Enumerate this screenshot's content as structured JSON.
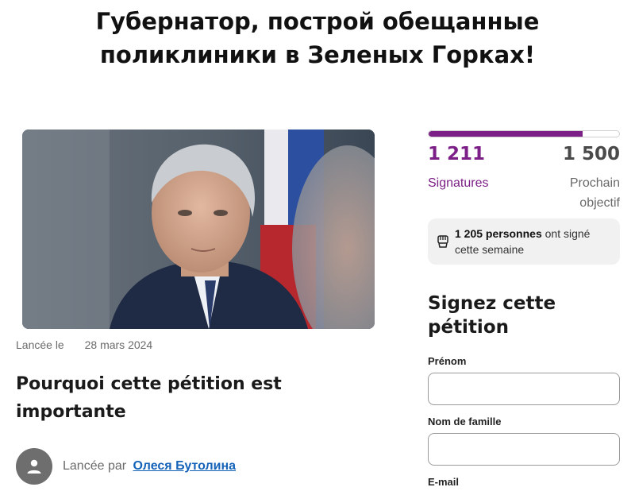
{
  "petition": {
    "title_line1": "Губернатор, построй обещанные",
    "title_line2": "поликлиники в Зеленых Горках!",
    "launched_label": "Lancée le",
    "launched_date": "28 mars 2024",
    "why_heading": "Pourquoi cette pétition est importante",
    "author_prefix": "Lancée par",
    "author_name": "Олеся Бутолина"
  },
  "stats": {
    "signatures_count": "1 211",
    "signatures_label": "Signatures",
    "goal_count": "1 500",
    "goal_label": "Prochain objectif",
    "progress_fraction": 0.807,
    "week_count": "1 205 personnes",
    "week_text": " ont signé cette semaine",
    "accent_color": "#7c1f86"
  },
  "form": {
    "heading": "Signez cette pétition",
    "first_name_label": "Prénom",
    "first_name_value": "",
    "last_name_label": "Nom de famille",
    "last_name_value": "",
    "email_label": "E-mail"
  },
  "icons": {
    "avatar": "user-avatar-icon",
    "week": "raised-fist-icon"
  }
}
